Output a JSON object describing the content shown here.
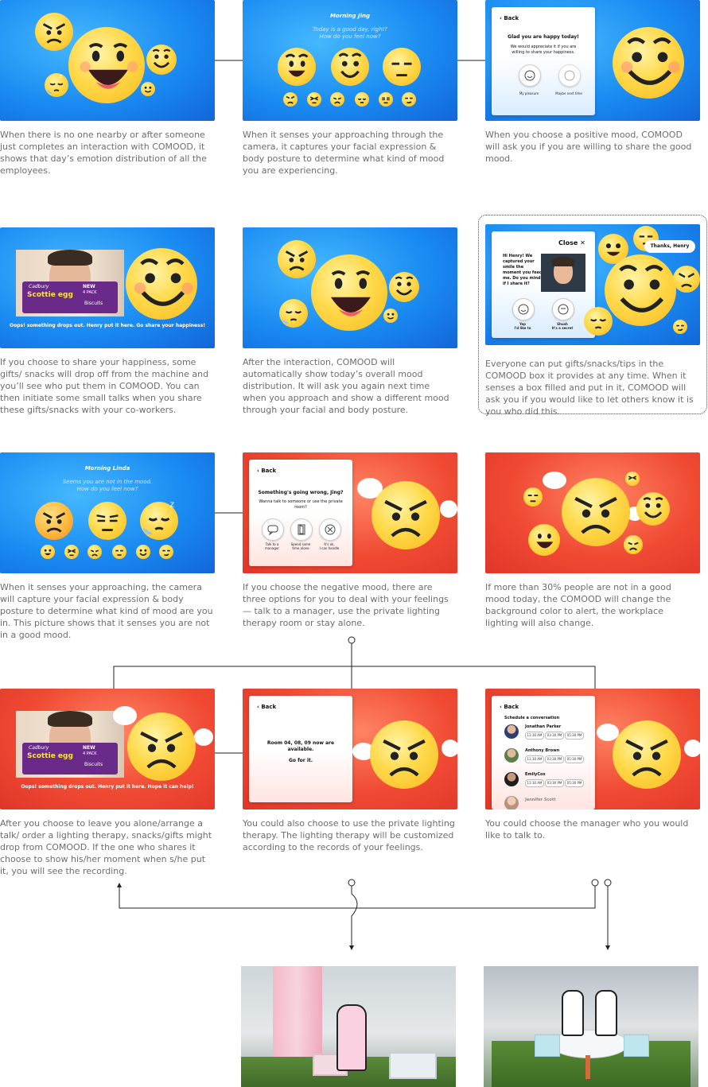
{
  "captions": {
    "c1": "When there is no one nearby or after someone just completes an interaction with COMOOD, it shows that day’s emotion distribution of all the employees.",
    "c2": "When it senses your approaching through the camera, it captures your facial expression & body posture to determine what kind of mood you are experiencing.",
    "c3": "When you choose a positive mood, COMOOD will ask you if you are willing to share the good mood.",
    "c4": "If you choose to share your happiness, some gifts/ snacks will drop off from the machine and you’ll see who put them in COMOOD. You can then initiate some small talks when you share these gifts/snacks with your co-workers.",
    "c5": "After the interaction, COMOOD will automatically show today’s overall mood distribution. It will ask you again next time when you approach and show a different mood through your facial and body posture.",
    "c6": "Everyone can put gifts/snacks/tips in the COMOOD box it provides at any time. When it senses a box filled and put in it, COMOOD will ask you if you would like to let others know it is you who did this.",
    "c7": "When it senses your approaching, the camera will capture your facial expression & body posture to determine what kind of mood are you in. This picture shows that it senses you are not in a good mood.",
    "c8": "If you choose the negative mood, there are three options for you to deal with your feelings — talk to a manager, use the private lighting therapy room or stay alone.",
    "c9": "If more than 30% people are not in a good mood today, the COMOOD will change the background color to alert, the workplace lighting will also change.",
    "c10": "After you choose to leave you alone/arrange a talk/ order a lighting therapy, snacks/gifts might drop from COMOOD. If the one who shares it choose to show his/her moment when s/he put it, you will see the recording.",
    "c11": "You could also choose to use the private lighting therapy. The lighting therapy will be customized according to the records of your feelings.",
    "c12": "You could choose the manager who you would like to talk to."
  },
  "p2": {
    "title": "Morning Jing",
    "subtitle1": "Today is a good day, right?",
    "subtitle2": "How do you feel now?"
  },
  "p3": {
    "back": "Back",
    "heading": "Glad you are happy today!",
    "body": "We would appreciate it if you are willing to share your happiness.",
    "opt1": "My pleasure",
    "opt2": "Maybe next time"
  },
  "p4": {
    "banner": "Oops! something drops out. Henry put it here. Go share your happiness!"
  },
  "p6": {
    "close": "Close",
    "body": "Hi Henry! We captured your smile the moment you feed me. Do you mind if I share it?",
    "opt1a": "Yep",
    "opt1b": "I'd like to",
    "opt2a": "Shush",
    "opt2b": "It's a secret",
    "thanks": "Thanks, Henry"
  },
  "p7": {
    "title": "Morning Linda",
    "subtitle1": "Seems you are not in the mood.",
    "subtitle2": "How do you feel now?"
  },
  "p8": {
    "back": "Back",
    "heading": "Something's going wrong, Jing?",
    "body": "Wanna talk to someone or use the private room?",
    "opt1a": "Talk to a",
    "opt1b": "manager",
    "opt2a": "Spend some",
    "opt2b": "time alone",
    "opt3a": "It's ok,",
    "opt3b": "I can handle"
  },
  "p10": {
    "banner": "Oops! something drops out. Henry put it here. Hope it can help!"
  },
  "p11": {
    "back": "Back",
    "line1": "Room 04, 08, 09 now are",
    "line2": "available.",
    "line3": "Go for it."
  },
  "p12": {
    "back": "Back",
    "heading": "Schedule a conversation",
    "managers": [
      "Jonathan  Parker",
      "Anthony Brown",
      "EmilyCox",
      "Jennifer Scott"
    ],
    "slots": [
      "11:30 AM",
      "03:30 PM",
      "05:30 PM"
    ]
  },
  "snack": {
    "brand": "Cadbury",
    "name": "Scottie egg",
    "badge1": "NEW",
    "badge2": "4 PACK",
    "type": "Biscuits"
  },
  "colors": {
    "blue": "#1a8cf2",
    "red": "#f04a33",
    "emoji": "#ffd94a",
    "caption": "#6d6d6d",
    "line": "#222222"
  }
}
